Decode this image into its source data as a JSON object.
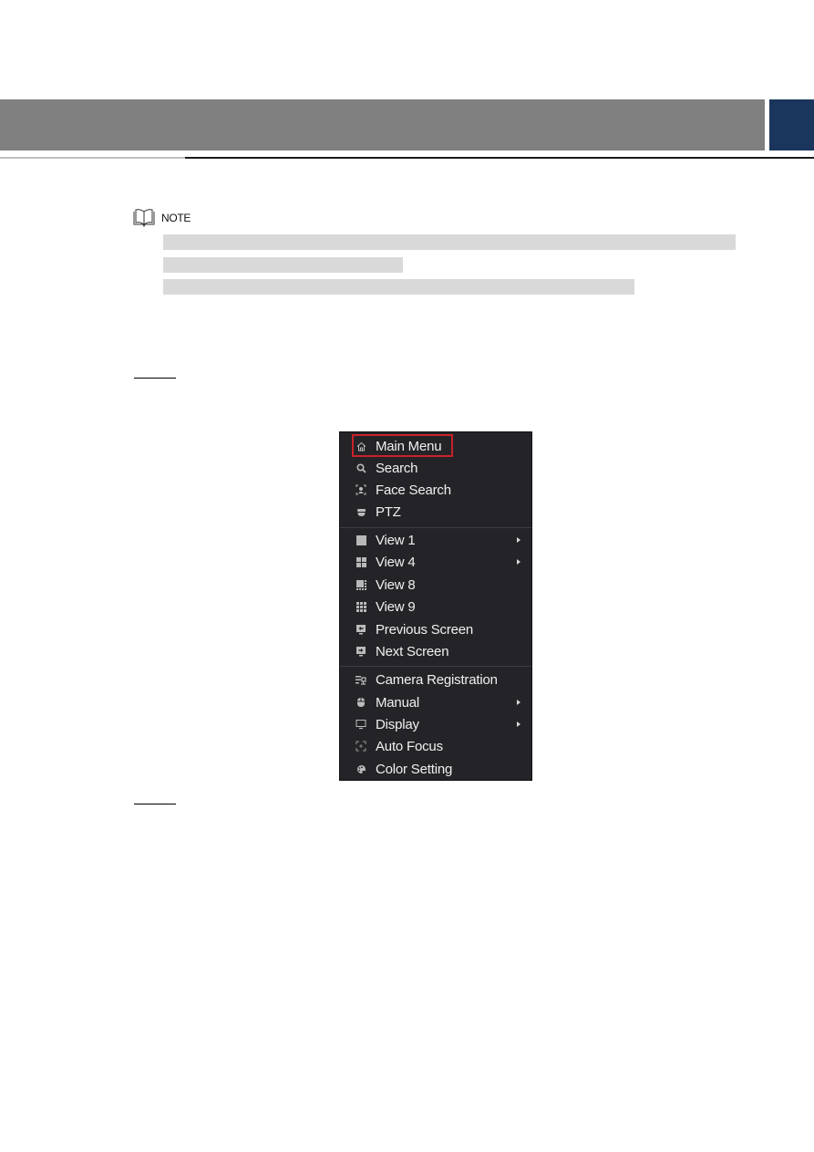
{
  "page": {
    "header_colors": {
      "bar": "#808080",
      "tab": "#1b365d"
    }
  },
  "note": {
    "label": "NOTE",
    "icon": "book-icon",
    "redacted_lines": 3
  },
  "steps": [
    {
      "label": ""
    },
    {
      "label": ""
    }
  ],
  "context_menu": {
    "highlight_color": "#c8222a",
    "groups": [
      [
        {
          "label": "Main Menu",
          "icon": "home-icon",
          "submenu": false,
          "highlighted": true
        },
        {
          "label": "Search",
          "icon": "search-icon",
          "submenu": false
        },
        {
          "label": "Face Search",
          "icon": "face-icon",
          "submenu": false
        },
        {
          "label": "PTZ",
          "icon": "ptz-camera-icon",
          "submenu": false
        }
      ],
      [
        {
          "label": "View 1",
          "icon": "view1-icon",
          "submenu": true
        },
        {
          "label": "View 4",
          "icon": "view4-icon",
          "submenu": true
        },
        {
          "label": "View 8",
          "icon": "view8-icon",
          "submenu": false
        },
        {
          "label": "View 9",
          "icon": "view9-icon",
          "submenu": false
        },
        {
          "label": "Previous Screen",
          "icon": "previous-screen-icon",
          "submenu": false
        },
        {
          "label": "Next Screen",
          "icon": "next-screen-icon",
          "submenu": false
        }
      ],
      [
        {
          "label": "Camera Registration",
          "icon": "camera-registration-icon",
          "submenu": false
        },
        {
          "label": "Manual",
          "icon": "manual-record-icon",
          "submenu": true
        },
        {
          "label": "Display",
          "icon": "display-icon",
          "submenu": true
        },
        {
          "label": "Auto Focus",
          "icon": "auto-focus-icon",
          "submenu": false
        },
        {
          "label": "Color Setting",
          "icon": "color-setting-icon",
          "submenu": false
        }
      ]
    ]
  }
}
